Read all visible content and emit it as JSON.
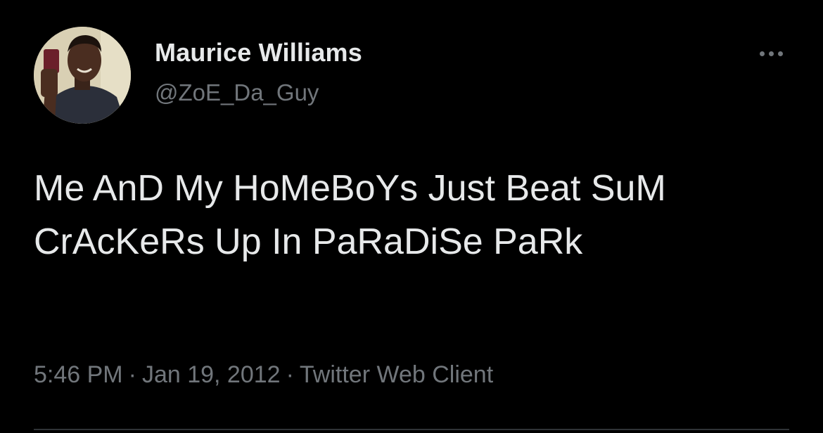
{
  "author": {
    "display_name": "Maurice Williams",
    "handle": "@ZoE_Da_Guy",
    "avatar_icon": "profile-photo"
  },
  "more_icon": "more-options-icon",
  "tweet": {
    "text": "Me AnD My HoMeBoYs Just Beat SuM CrAcKeRs Up In PaRaDiSe PaRk"
  },
  "meta": {
    "time": "5:46 PM",
    "separator": "·",
    "date": "Jan 19, 2012",
    "source": "Twitter Web Client"
  },
  "colors": {
    "background": "#000000",
    "primary_text": "#e7e9ea",
    "secondary_text": "#71767b",
    "divider": "#2f3336"
  }
}
